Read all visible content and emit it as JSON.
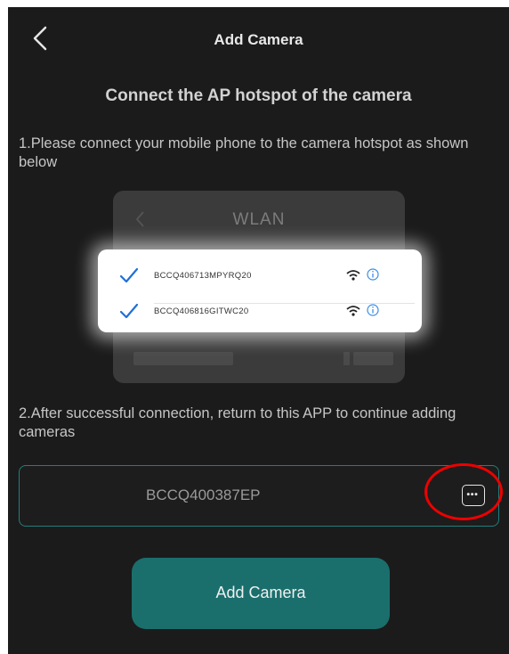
{
  "header": {
    "back_icon": "chevron-left-icon",
    "title": "Add Camera"
  },
  "heading": "Connect the AP hotspot of the camera",
  "steps": {
    "step1": "1.Please connect your mobile phone to the camera hotspot as shown below",
    "step2": "2.After successful connection, return to this APP to continue adding cameras"
  },
  "illustration": {
    "title": "WLAN",
    "networks": [
      {
        "ssid": "BCCQ406713MPYRQ20",
        "checked": true
      },
      {
        "ssid": "BCCQ406816GITWC20",
        "checked": true
      }
    ]
  },
  "device_field": {
    "value": "BCCQ400387EP",
    "more_icon": "more-dots-icon"
  },
  "primary_button": {
    "label": "Add Camera"
  },
  "colors": {
    "accent": "#1a6f6d",
    "background": "#1b1b1b",
    "highlight": "#e00000",
    "check": "#1f6fd8"
  }
}
